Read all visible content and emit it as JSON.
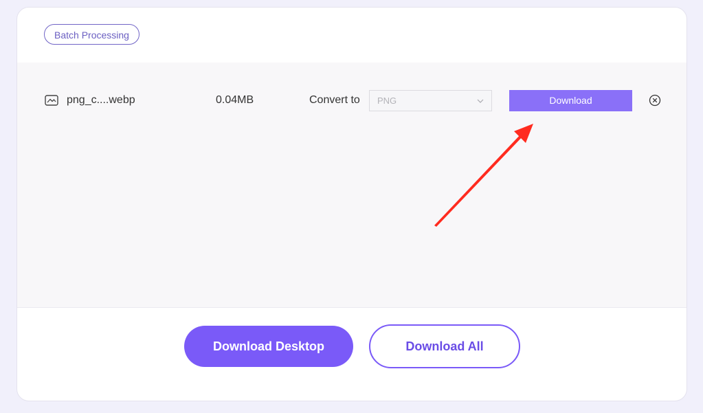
{
  "batch_tag": "Batch Processing",
  "file": {
    "name": "png_c....webp",
    "size": "0.04MB",
    "convert_label": "Convert to",
    "format_value": "PNG",
    "download_label": "Download"
  },
  "actions": {
    "download_desktop": "Download Desktop",
    "download_all": "Download All"
  },
  "colors": {
    "accent": "#7a5af8",
    "download_button": "#8a70f8",
    "annotation_arrow": "#ff2b1f"
  },
  "icons": {
    "file": "image-file-icon",
    "dropdown": "chevron-down-icon",
    "remove": "close-circle-icon",
    "annotation": "red-arrow-annotation"
  }
}
